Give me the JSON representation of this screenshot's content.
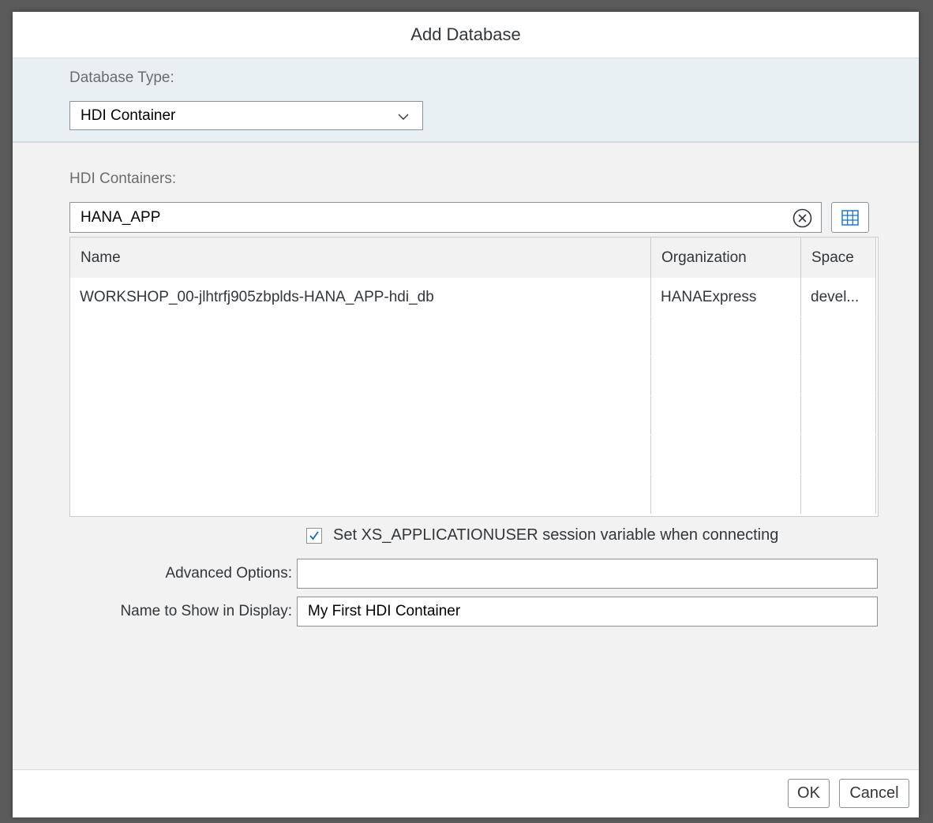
{
  "dialog": {
    "title": "Add Database",
    "database_type": {
      "label": "Database Type:",
      "selected": "HDI Container"
    },
    "containers": {
      "label": "HDI Containers:",
      "search_value": "HANA_APP",
      "columns": [
        "Name",
        "Organization",
        "Space"
      ],
      "rows": [
        [
          "WORKSHOP_00-jlhtrfj905zbplds-HANA_APP-hdi_db",
          "HANAExpress",
          "devel..."
        ]
      ]
    },
    "session_checkbox": {
      "label": "Set XS_APPLICATIONUSER session variable when connecting",
      "checked": true
    },
    "advanced_options": {
      "label": "Advanced Options:",
      "value": ""
    },
    "display_name": {
      "label": "Name to Show in Display:",
      "value": "My First HDI Container"
    },
    "buttons": {
      "ok": "OK",
      "cancel": "Cancel"
    }
  },
  "colors": {
    "header_bg": "#ffffff",
    "type_band_bg": "#e9f0f4",
    "content_bg": "#f2f2f2",
    "accent": "#0a6ed1",
    "overlay": "#5b5b5b"
  }
}
